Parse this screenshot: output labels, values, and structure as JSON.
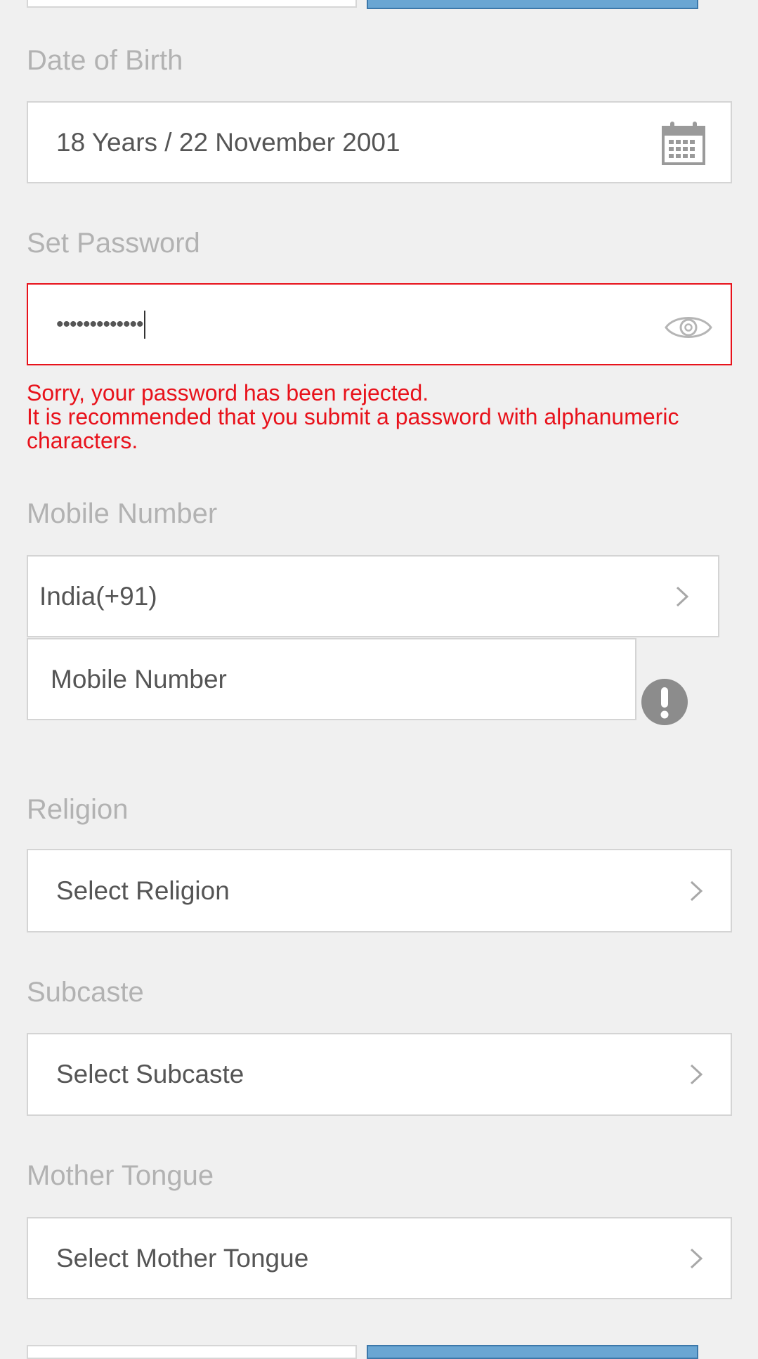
{
  "date_of_birth": {
    "label": "Date of Birth",
    "value": "18 Years / 22 November 2001",
    "icon": "calendar-icon"
  },
  "password": {
    "label": "Set Password",
    "value": "•••••••••••••",
    "icon": "eye-icon",
    "error_line1": "Sorry, your password has been rejected.",
    "error_line2": "It is recommended that you submit a password with alphanumeric characters.",
    "error_color": "#e8121b"
  },
  "mobile": {
    "label": "Mobile Number",
    "country_value": "India(+91)",
    "number_placeholder": "Mobile Number",
    "warning_icon": "exclamation-icon"
  },
  "religion": {
    "label": "Religion",
    "placeholder": "Select Religion"
  },
  "subcaste": {
    "label": "Subcaste",
    "placeholder": "Select Subcaste"
  },
  "mother_tongue": {
    "label": "Mother Tongue",
    "placeholder": "Select Mother Tongue"
  },
  "colors": {
    "background": "#f0f0f0",
    "label": "#b2b2b2",
    "input_text": "#555555",
    "accent_button": "#6aa6d3"
  }
}
